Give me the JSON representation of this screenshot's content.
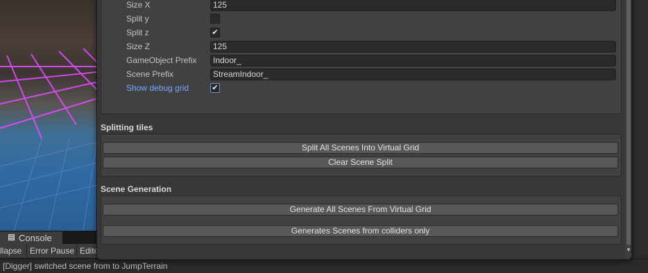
{
  "inspector": {
    "fields": [
      {
        "label": "Size X",
        "type": "text",
        "value": "125"
      },
      {
        "label": "Split y",
        "type": "checkbox",
        "checked": false
      },
      {
        "label": "Split z",
        "type": "checkbox",
        "checked": true
      },
      {
        "label": "Size Z",
        "type": "text",
        "value": "125"
      },
      {
        "label": "GameObject Prefix",
        "type": "text",
        "value": "Indoor_"
      },
      {
        "label": "Scene Prefix",
        "type": "text",
        "value": "StreamIndoor_"
      },
      {
        "label": "Show debug grid",
        "type": "checkbox",
        "checked": true
      }
    ],
    "sections": {
      "splitting": {
        "title": "Splitting tiles",
        "buttons": [
          "Split All Scenes Into Virtual Grid",
          "Clear Scene Split"
        ]
      },
      "generation": {
        "title": "Scene Generation",
        "buttons": [
          "Generate All Scenes From Virtual Grid",
          "Generates Scenes from colliders only"
        ]
      }
    }
  },
  "console": {
    "tab_label": "Console",
    "toolbar": [
      "llapse",
      "Error Pause",
      "Edito"
    ],
    "status_text": "[Digger] switched scene from  to JumpTerrain"
  },
  "icons": {
    "console_tab": "console-icon",
    "checkmark": "checkmark-icon",
    "scroll_down": "scroll-down-arrow-icon"
  }
}
